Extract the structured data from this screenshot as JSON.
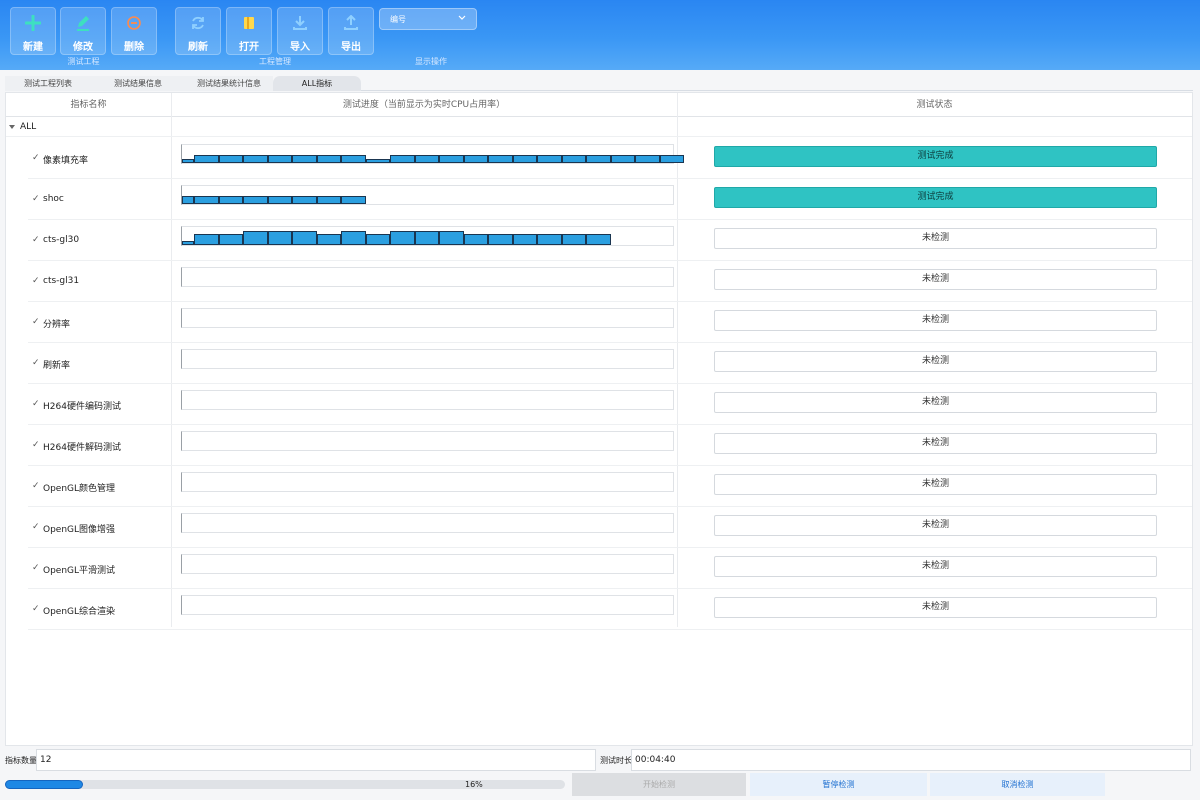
{
  "toolbar": {
    "buttons": [
      {
        "label": "新建",
        "icon": "plus-icon",
        "color": "#3de0c0"
      },
      {
        "label": "修改",
        "icon": "edit-icon",
        "color": "#3de0c0"
      },
      {
        "label": "删除",
        "icon": "minus-circle-icon",
        "color": "#ff8a4c"
      },
      {
        "label": "刷新",
        "icon": "refresh-icon",
        "color": "#8fd0ff"
      },
      {
        "label": "打开",
        "icon": "open-book-icon",
        "color": "#ffd84d"
      },
      {
        "label": "导入",
        "icon": "download-icon",
        "color": "#8fd0ff"
      },
      {
        "label": "导出",
        "icon": "upload-icon",
        "color": "#8fd0ff"
      }
    ],
    "groups": {
      "project": "测试工程",
      "manage": "工程管理",
      "display": "显示操作"
    },
    "sort_combo": {
      "value": "编号"
    }
  },
  "tabs": [
    {
      "label": "测试工程列表",
      "active": false
    },
    {
      "label": "测试结果信息",
      "active": false
    },
    {
      "label": "测试结果统计信息",
      "active": false
    },
    {
      "label": "ALL指标",
      "active": true
    }
  ],
  "table": {
    "headers": {
      "name": "指标名称",
      "progress": "测试进度（当前显示为实时CPU占用率）",
      "status": "测试状态"
    },
    "root": "ALL",
    "rows": [
      {
        "name": "像素填充率",
        "status": "测试完成",
        "done": true,
        "cpu": [
          0.2,
          0.45,
          0.45,
          0.45,
          0.45,
          0.45,
          0.45,
          0.45,
          0.2,
          0.45,
          0.45,
          0.45,
          0.45,
          0.45,
          0.45,
          0.45,
          0.45,
          0.45,
          0.45,
          0.45,
          0.45
        ]
      },
      {
        "name": "shoc",
        "status": "测试完成",
        "done": true,
        "cpu": [
          0.45,
          0.45,
          0.45,
          0.45,
          0.45,
          0.45,
          0.45,
          0.45
        ]
      },
      {
        "name": "cts-gl30",
        "status": "未检测",
        "done": false,
        "cpu": [
          0.2,
          0.6,
          0.6,
          0.8,
          0.8,
          0.8,
          0.6,
          0.8,
          0.6,
          0.8,
          0.8,
          0.8,
          0.6,
          0.6,
          0.6,
          0.6,
          0.6,
          0.6
        ]
      },
      {
        "name": "cts-gl31",
        "status": "未检测",
        "done": false,
        "cpu": []
      },
      {
        "name": "分辨率",
        "status": "未检测",
        "done": false,
        "cpu": []
      },
      {
        "name": "刷新率",
        "status": "未检测",
        "done": false,
        "cpu": []
      },
      {
        "name": "H264硬件编码测试",
        "status": "未检测",
        "done": false,
        "cpu": []
      },
      {
        "name": "H264硬件解码测试",
        "status": "未检测",
        "done": false,
        "cpu": []
      },
      {
        "name": "OpenGL颜色管理",
        "status": "未检测",
        "done": false,
        "cpu": []
      },
      {
        "name": "OpenGL图像增强",
        "status": "未检测",
        "done": false,
        "cpu": []
      },
      {
        "name": "OpenGL平滑测试",
        "status": "未检测",
        "done": false,
        "cpu": []
      },
      {
        "name": "OpenGL综合渲染",
        "status": "未检测",
        "done": false,
        "cpu": []
      }
    ]
  },
  "footer": {
    "count_label": "指标数量",
    "count_value": "12",
    "duration_label": "测试时长",
    "duration_value": "00:04:40",
    "progress_percent": 16,
    "progress_text": "16%",
    "start_label": "开始检测",
    "pause_label": "暂停检测",
    "cancel_label": "取消检测"
  }
}
